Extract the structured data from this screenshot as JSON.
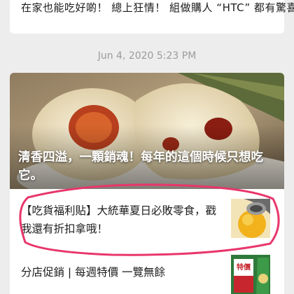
{
  "previous_message": {
    "text": "在家也能吃好啲！ 總上狂情！ 組做購人 “HTC” 都有驚喜！"
  },
  "timestamp": "Jun 4, 2020 5:23 PM",
  "article": {
    "cover_title": "清香四溢，一顆銷魂！每年的這個時候只想吃它。",
    "items": [
      {
        "title": "【吃貨福利貼】大統華夏日必敗零食，戳我還有折扣拿哦！",
        "thumb_icon": "ice-cream-thumbnail"
      },
      {
        "title": "分店促銷 | 每週特價 一覽無餘",
        "thumb_icon": "sale-poster-thumbnail",
        "thumb_label": "特價商品"
      }
    ]
  },
  "colors": {
    "annotation_ring": "#e8366b",
    "background": "#ededed",
    "timestamp": "#9b9b9b"
  }
}
